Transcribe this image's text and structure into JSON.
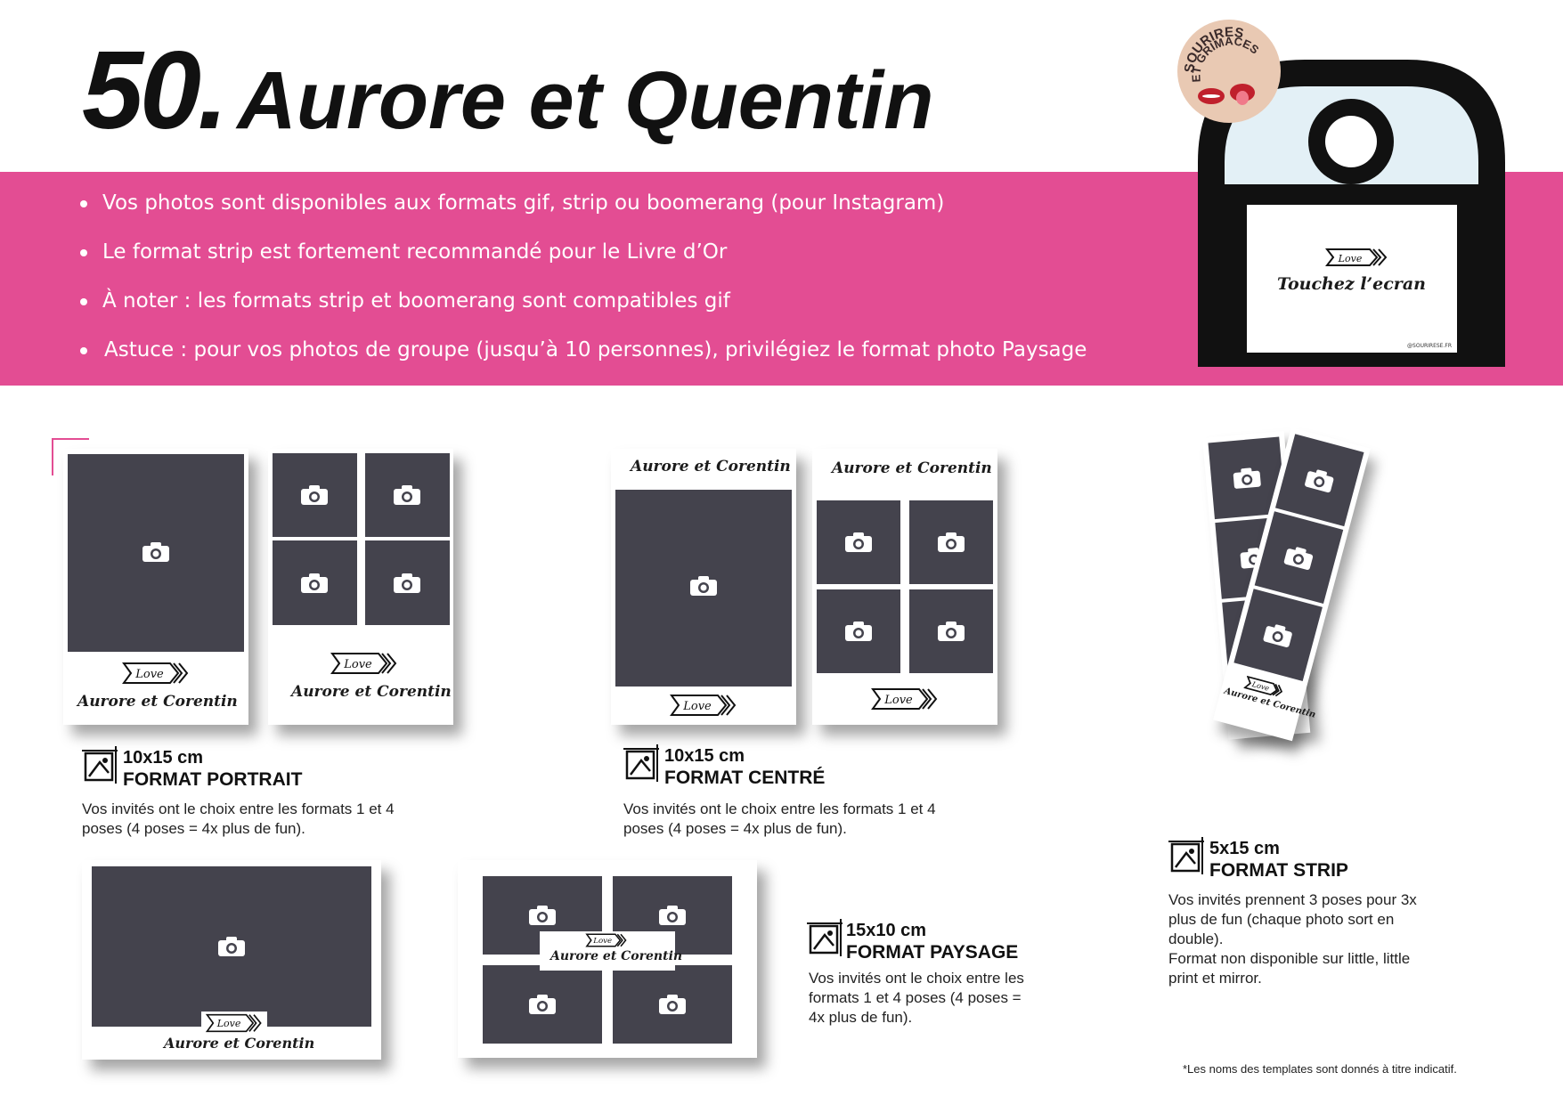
{
  "header": {
    "number": "50.",
    "name": "Aurore et Quentin"
  },
  "bullets": [
    "Vos photos sont disponibles aux formats gif, strip ou boomerang (pour Instagram)",
    "Le format strip est fortement recommandé pour le Livre d’Or",
    "À noter : les formats strip et boomerang sont compatibles gif",
    "Astuce : pour vos photos de groupe (jusqu’à 10 personnes), privilégiez le format photo Paysage"
  ],
  "badge": {
    "line1": "SOURIRES",
    "line2": "ET GRIMACES"
  },
  "booth_screen": {
    "love": "Love",
    "touch": "Touchez l’ecran",
    "credit": "@SOURIRESE.FR"
  },
  "template": {
    "names": "Aurore et Corentin",
    "love": "Love"
  },
  "formats": {
    "portrait": {
      "size": "10x15 cm",
      "name": "FORMAT PORTRAIT",
      "desc": "Vos invités ont le choix entre les formats 1 et 4 poses (4 poses = 4x plus de fun)."
    },
    "centre": {
      "size": "10x15 cm",
      "name": "FORMAT CENTRÉ",
      "desc": "Vos invités ont le choix entre les formats 1 et 4 poses (4 poses = 4x plus de fun)."
    },
    "paysage": {
      "size": "15x10 cm",
      "name": "FORMAT PAYSAGE",
      "desc": "Vos invités ont le choix entre les formats 1 et 4 poses (4 poses = 4x plus de fun)."
    },
    "strip": {
      "size": "5x15 cm",
      "name": "FORMAT STRIP",
      "desc": "Vos invités prennent 3 poses pour 3x plus de fun (chaque photo sort en double).",
      "desc2": "Format non disponible sur little, little print et mirror."
    }
  },
  "footnote": "*Les noms des templates sont donnés à titre indicatif.",
  "colors": {
    "accent": "#e34d93",
    "placeholder": "#44434d"
  },
  "icons": [
    "camera-icon",
    "format-size-icon",
    "love-arrow-icon"
  ]
}
